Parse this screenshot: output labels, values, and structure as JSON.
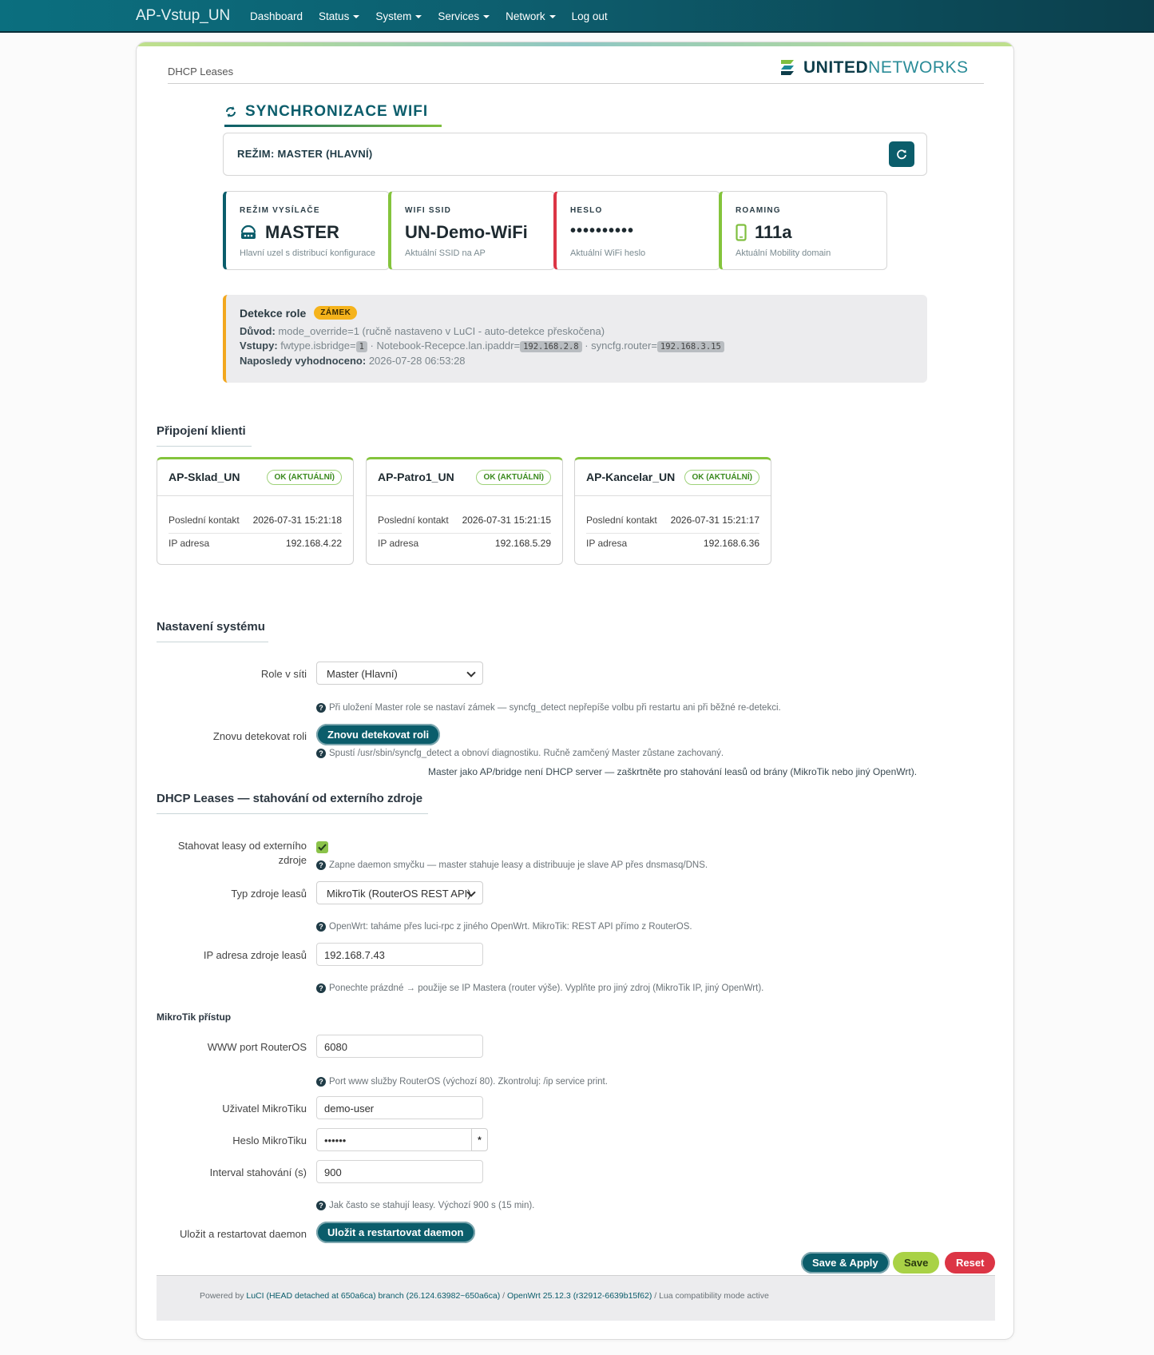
{
  "header": {
    "brand": "AP-Vstup_UN",
    "nav": [
      {
        "label": "Dashboard",
        "dropdown": false
      },
      {
        "label": "Status",
        "dropdown": true
      },
      {
        "label": "System",
        "dropdown": true
      },
      {
        "label": "Services",
        "dropdown": true
      },
      {
        "label": "Network",
        "dropdown": true
      },
      {
        "label": "Log out",
        "dropdown": false
      }
    ]
  },
  "breadcrumb": "DHCP Leases",
  "logo": {
    "bold": "UNITED",
    "light": "NETWORKS"
  },
  "sync": {
    "title": "SYNCHRONIZACE WIFI",
    "mode_label": "REŽIM: MASTER (HLAVNÍ)",
    "stats": [
      {
        "label": "REŽIM VYSÍLAČE",
        "value": "MASTER",
        "sub": "Hlavní uzel s distribucí konfigurace",
        "icon": "router-icon",
        "color": "#0b5d6b"
      },
      {
        "label": "WIFI SSID",
        "value": "UN-Demo-WiFi",
        "sub": "Aktuální SSID na AP",
        "color": "#84c43c"
      },
      {
        "label": "HESLO",
        "value": "••••••••••",
        "sub": "Aktuální WiFi heslo",
        "color": "#dc3545"
      },
      {
        "label": "ROAMING",
        "value": "111a",
        "sub": "Aktuální Mobility domain",
        "icon": "mobile-icon",
        "color": "#84c43c"
      }
    ]
  },
  "detection": {
    "title": "Detekce role",
    "badge": "ZÁMEK",
    "reason_label": "Důvod:",
    "reason_value": "mode_override=1 (ručně nastaveno v LuCI - auto-detekce přeskočena)",
    "inputs_label": "Vstupy:",
    "inputs_a": "fwtype.isbridge=",
    "inputs_a_code": "1",
    "inputs_b": " · Notebook-Recepce.lan.ipaddr=",
    "inputs_b_code": "192.168.2.8",
    "inputs_c": " · syncfg.router=",
    "inputs_c_code": "192.168.3.15",
    "last_label": "Naposledy vyhodnoceno:",
    "last_value": "2026-07-28 06:53:28"
  },
  "clients_section": {
    "title": "Připojení klienti",
    "contact_label": "Poslední kontakt",
    "ip_label": "IP adresa",
    "clients": [
      {
        "name": "AP-Sklad_UN",
        "status": "OK (AKTUÁLNÍ)",
        "last_contact": "2026-07-31 15:21:18",
        "ip": "192.168.4.22"
      },
      {
        "name": "AP-Patro1_UN",
        "status": "OK (AKTUÁLNÍ)",
        "last_contact": "2026-07-31 15:21:15",
        "ip": "192.168.5.29"
      },
      {
        "name": "AP-Kancelar_UN",
        "status": "OK (AKTUÁLNÍ)",
        "last_contact": "2026-07-31 15:21:17",
        "ip": "192.168.6.36"
      }
    ]
  },
  "system_section": {
    "title": "Nastavení systému",
    "role_label": "Role v síti",
    "role_value": "Master (Hlavní)",
    "role_hint": "Při uložení Master role se nastaví zámek — syncfg_detect nepřepíše volbu při restartu ani při běžné re-detekci.",
    "redetect_label": "Znovu detekovat roli",
    "redetect_button": "Znovu detekovat roli",
    "redetect_hint": "Spustí /usr/sbin/syncfg_detect a obnoví diagnostiku. Ručně zamčený Master zůstane zachovaný.",
    "note": "Master jako AP/bridge není DHCP server — zaškrtněte pro stahování leasů od brány (MikroTik nebo jiný OpenWrt)."
  },
  "dhcp_section": {
    "title": "DHCP Leases — stahování od externího zdroje",
    "fetch_label_1": "Stahovat leasy od externího",
    "fetch_label_2": "zdroje",
    "fetch_checked": true,
    "fetch_hint": "Zapne daemon smyčku — master stahuje leasy a distribuuje je slave AP přes dnsmasq/DNS.",
    "source_type_label": "Typ zdroje leasů",
    "source_type_value": "MikroTik (RouterOS REST API)",
    "source_type_hint": "OpenWrt: taháme přes luci-rpc z jiného OpenWrt. MikroTik: REST API přímo z RouterOS.",
    "source_ip_label": "IP adresa zdroje leasů",
    "source_ip_value": "192.168.7.43",
    "source_ip_hint": "Ponechte prázdné → použije se IP Mastera (router výše). Vyplňte pro jiný zdroj (MikroTik IP, jiný OpenWrt).",
    "mikrotik_heading": "MikroTik přístup",
    "port_label": "WWW port RouterOS",
    "port_value": "6080",
    "port_hint": "Port www služby RouterOS (výchozí 80). Zkontroluj: /ip service print.",
    "user_label": "Uživatel MikroTiku",
    "user_value": "demo-user",
    "pass_label": "Heslo MikroTiku",
    "pass_value": "••••••",
    "pass_toggle": "*",
    "interval_label": "Interval stahování (s)",
    "interval_value": "900",
    "interval_hint": "Jak často se stahují leasy. Výchozí 900 s (15 min).",
    "restart_label": "Uložit a restartovat daemon",
    "restart_button": "Uložit a restartovat daemon"
  },
  "actions": {
    "save_apply": "Save & Apply",
    "save": "Save",
    "reset": "Reset"
  },
  "footer": {
    "prefix": "Powered by ",
    "luci": "LuCI (HEAD detached at 650a6ca) branch (26.124.63982~650a6ca)",
    "sep1": " / ",
    "openwrt": "OpenWrt 25.12.3 (r32912-6639b15f62)",
    "suffix": " / Lua compatibility mode active"
  }
}
